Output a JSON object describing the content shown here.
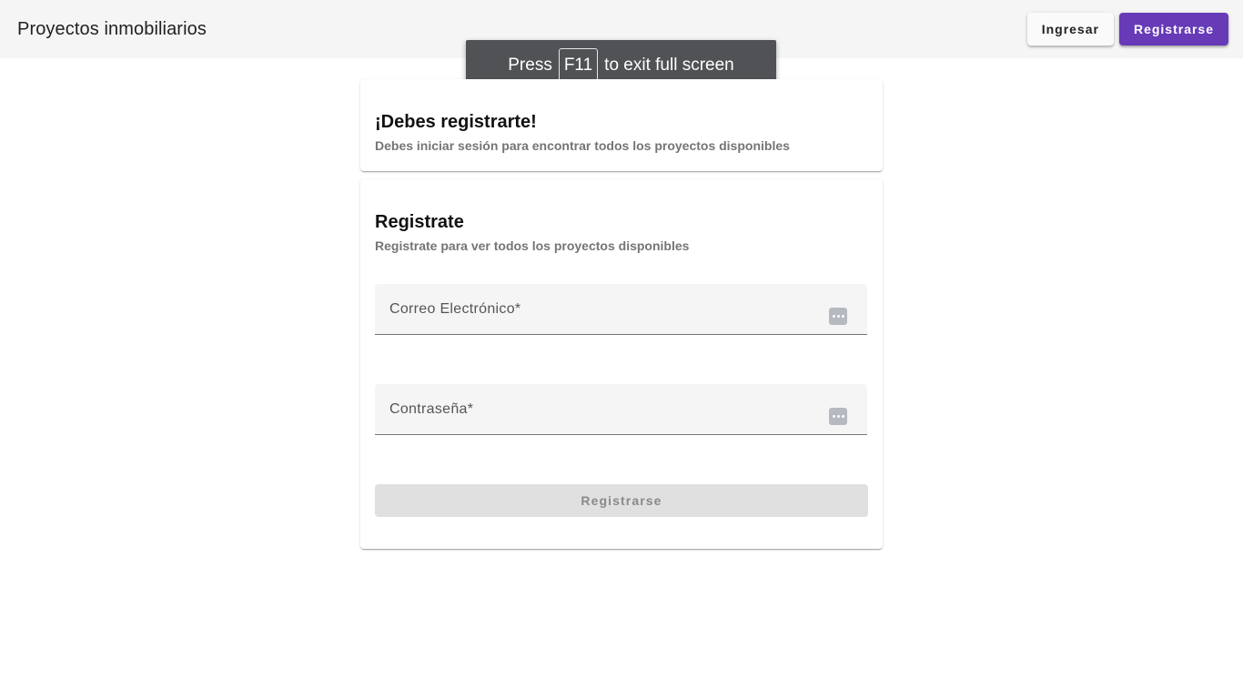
{
  "header": {
    "title": "Proyectos inmobiliarios",
    "login_label": "Ingresar",
    "register_label": "Registrarse"
  },
  "fullscreen_notice": {
    "prefix": "Press",
    "key": "F11",
    "suffix": "to exit full screen"
  },
  "notice_card": {
    "title": "¡Debes registrarte!",
    "subtitle": "Debes iniciar sesión para encontrar todos los proyectos disponibles"
  },
  "register_card": {
    "title": "Registrate",
    "subtitle": "Registrate para ver todos los proyectos disponibles",
    "email_label": "Correo Electrónico*",
    "email_value": "",
    "password_label": "Contraseña*",
    "password_value": "",
    "submit_label": "Registrarse"
  },
  "colors": {
    "primary": "#673ab7",
    "toolbar_bg": "#f5f5f5",
    "disabled_bg": "#e0e0e0"
  }
}
